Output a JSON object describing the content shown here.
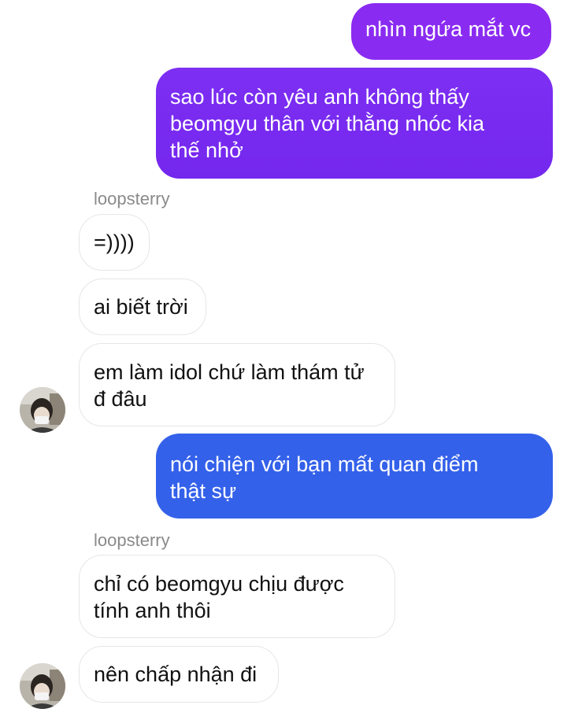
{
  "messages": [
    {
      "id": "m1",
      "from": "me",
      "text": "nhìn ngứa mắt vc"
    },
    {
      "id": "m2",
      "from": "me",
      "text": "sao lúc còn yêu anh không thấy\nbeomgyu thân với thằng nhóc kia\nthế nhở"
    },
    {
      "id": "n1",
      "sender": "loopsterry"
    },
    {
      "id": "m3",
      "from": "loopsterry",
      "text": "=))))"
    },
    {
      "id": "m4",
      "from": "loopsterry",
      "text": "ai biết trời"
    },
    {
      "id": "m5",
      "from": "loopsterry",
      "text": "em làm idol chứ làm thám tử\nđ đâu"
    },
    {
      "id": "m6",
      "from": "me",
      "text": "nói chiện với bạn mất quan điểm\nthật sự"
    },
    {
      "id": "n2",
      "sender": "loopsterry"
    },
    {
      "id": "m7",
      "from": "loopsterry",
      "text": "chỉ có beomgyu chịu được\ntính anh thôi"
    },
    {
      "id": "m8",
      "from": "loopsterry",
      "text": "nên chấp nhận đi"
    }
  ],
  "colors": {
    "sent_gradient_top": "#7a2cf0",
    "sent_gradient_bottom": "#2f63ec",
    "received_border": "#e6e6e6",
    "sender_name": "#8a8a8a"
  },
  "icons": {
    "avatar": "avatar-photo-icon"
  }
}
